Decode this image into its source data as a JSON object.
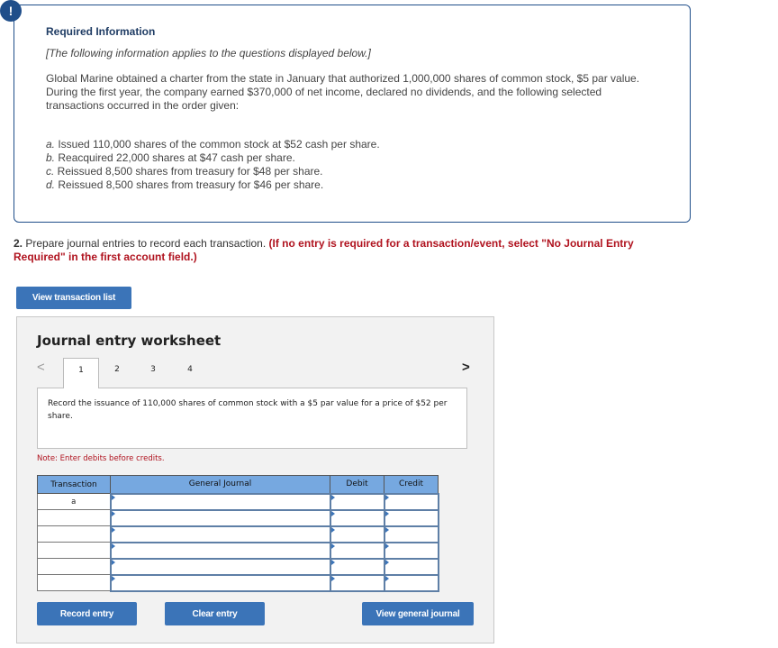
{
  "info": {
    "badge": "!",
    "title": "Required Information",
    "italic_note": "[The following information applies to the questions displayed below.]",
    "paragraph": "Global Marine obtained a charter from the state in January that authorized 1,000,000 shares of common stock, $5 par value. During the first year, the company earned $370,000 of net income, declared no dividends, and the following selected transactions occurred in the order given:",
    "transactions": [
      {
        "letter": "a.",
        "text": " Issued 110,000 shares of the common stock at $52 cash per share."
      },
      {
        "letter": "b.",
        "text": " Reacquired 22,000 shares at $47 cash per share."
      },
      {
        "letter": "c.",
        "text": " Reissued 8,500 shares from treasury for $48 per share."
      },
      {
        "letter": "d.",
        "text": " Reissued 8,500 shares from treasury for $46 per share."
      }
    ]
  },
  "question": {
    "number": "2.",
    "text": " Prepare journal entries to record each transaction. ",
    "instruction": "(If no entry is required for a transaction/event, select \"No Journal Entry Required\" in the first account field.)"
  },
  "buttons": {
    "view_transaction_list": "View transaction list",
    "record_entry": "Record entry",
    "clear_entry": "Clear entry",
    "view_general_journal": "View general journal"
  },
  "worksheet": {
    "title": "Journal entry worksheet",
    "prev_icon": "<",
    "next_icon": ">",
    "tabs": [
      "1",
      "2",
      "3",
      "4"
    ],
    "active_tab": "1",
    "description": "Record the issuance of 110,000 shares of common stock with a $5 par value for a price of $52 per share.",
    "note": "Note: Enter debits before credits.",
    "columns": [
      "Transaction",
      "General Journal",
      "Debit",
      "Credit"
    ],
    "rows": [
      {
        "transaction": "a",
        "account": "",
        "debit": "",
        "credit": ""
      },
      {
        "transaction": "",
        "account": "",
        "debit": "",
        "credit": ""
      },
      {
        "transaction": "",
        "account": "",
        "debit": "",
        "credit": ""
      },
      {
        "transaction": "",
        "account": "",
        "debit": "",
        "credit": ""
      },
      {
        "transaction": "",
        "account": "",
        "debit": "",
        "credit": ""
      },
      {
        "transaction": "",
        "account": "",
        "debit": "",
        "credit": ""
      }
    ]
  },
  "colors": {
    "accent_blue": "#3b74b8",
    "header_blue": "#76a8e0",
    "border_navy": "#1f4e8a",
    "warning_red": "#b0131f"
  }
}
